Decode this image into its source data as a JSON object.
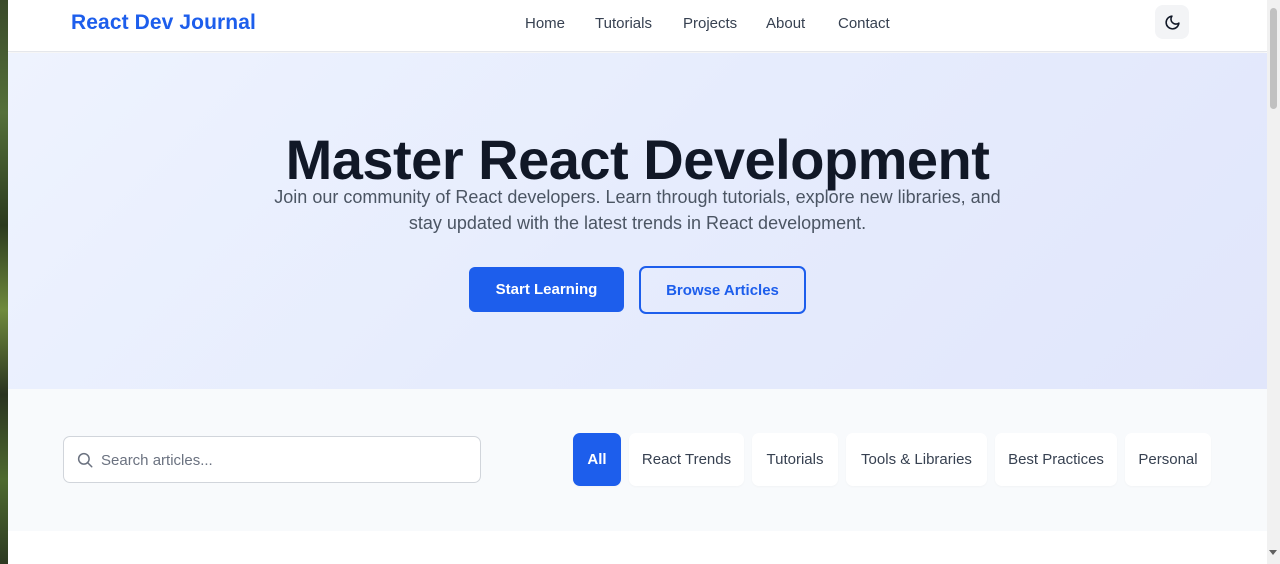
{
  "header": {
    "logo": "React Dev Journal",
    "nav": [
      "Home",
      "Tutorials",
      "Projects",
      "About",
      "Contact"
    ],
    "theme_toggle_icon": "moon-icon"
  },
  "hero": {
    "title": "Master React Development",
    "subtitle": "Join our community of React developers. Learn through tutorials, explore new libraries, and stay updated with the latest trends in React development.",
    "primary_button": "Start Learning",
    "secondary_button": "Browse Articles"
  },
  "filters": {
    "search_placeholder": "Search articles...",
    "search_value": "",
    "categories": [
      "All",
      "React Trends",
      "Tutorials",
      "Tools & Libraries",
      "Best Practices",
      "Personal"
    ],
    "active_category": "All"
  },
  "colors": {
    "accent": "#1d5eec",
    "hero_bg": "#e6ecfd",
    "text_dark": "#111827"
  }
}
